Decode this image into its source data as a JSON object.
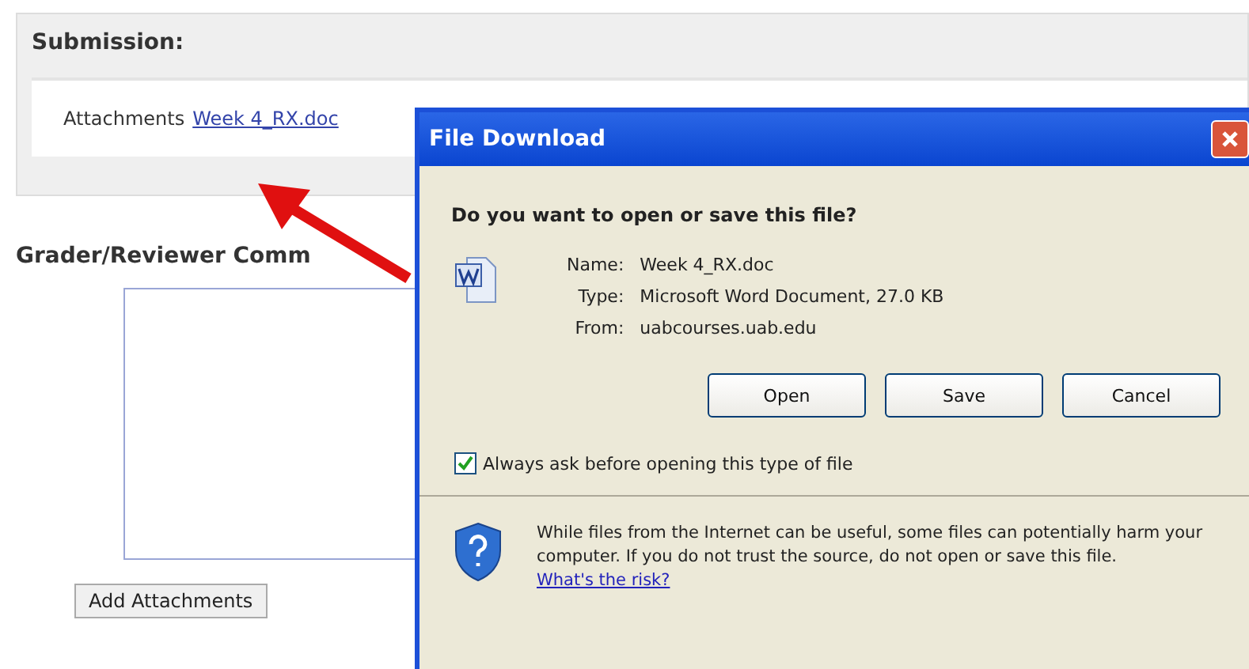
{
  "page": {
    "section_title": "Submission:",
    "attachments_label": "Attachments",
    "attachment_link": "Week 4_RX.doc",
    "comments_heading": "Grader/Reviewer Comm",
    "add_button": "Add Attachments"
  },
  "dialog": {
    "title": "File Download",
    "question": "Do you want to open or save this file?",
    "fields": [
      {
        "label": "Name:",
        "value": "Week 4_RX.doc"
      },
      {
        "label": "Type:",
        "value": "Microsoft Word Document, 27.0 KB"
      },
      {
        "label": "From:",
        "value": "uabcourses.uab.edu"
      }
    ],
    "buttons": [
      "Open",
      "Save",
      "Cancel"
    ],
    "checkbox": {
      "label": "Always ask before opening this type of file",
      "checked": true
    },
    "warning": "While files from the Internet can be useful, some files can potentially harm your computer. If you do not trust the source, do not open or save this file.",
    "risk_link": "What's the risk?"
  }
}
